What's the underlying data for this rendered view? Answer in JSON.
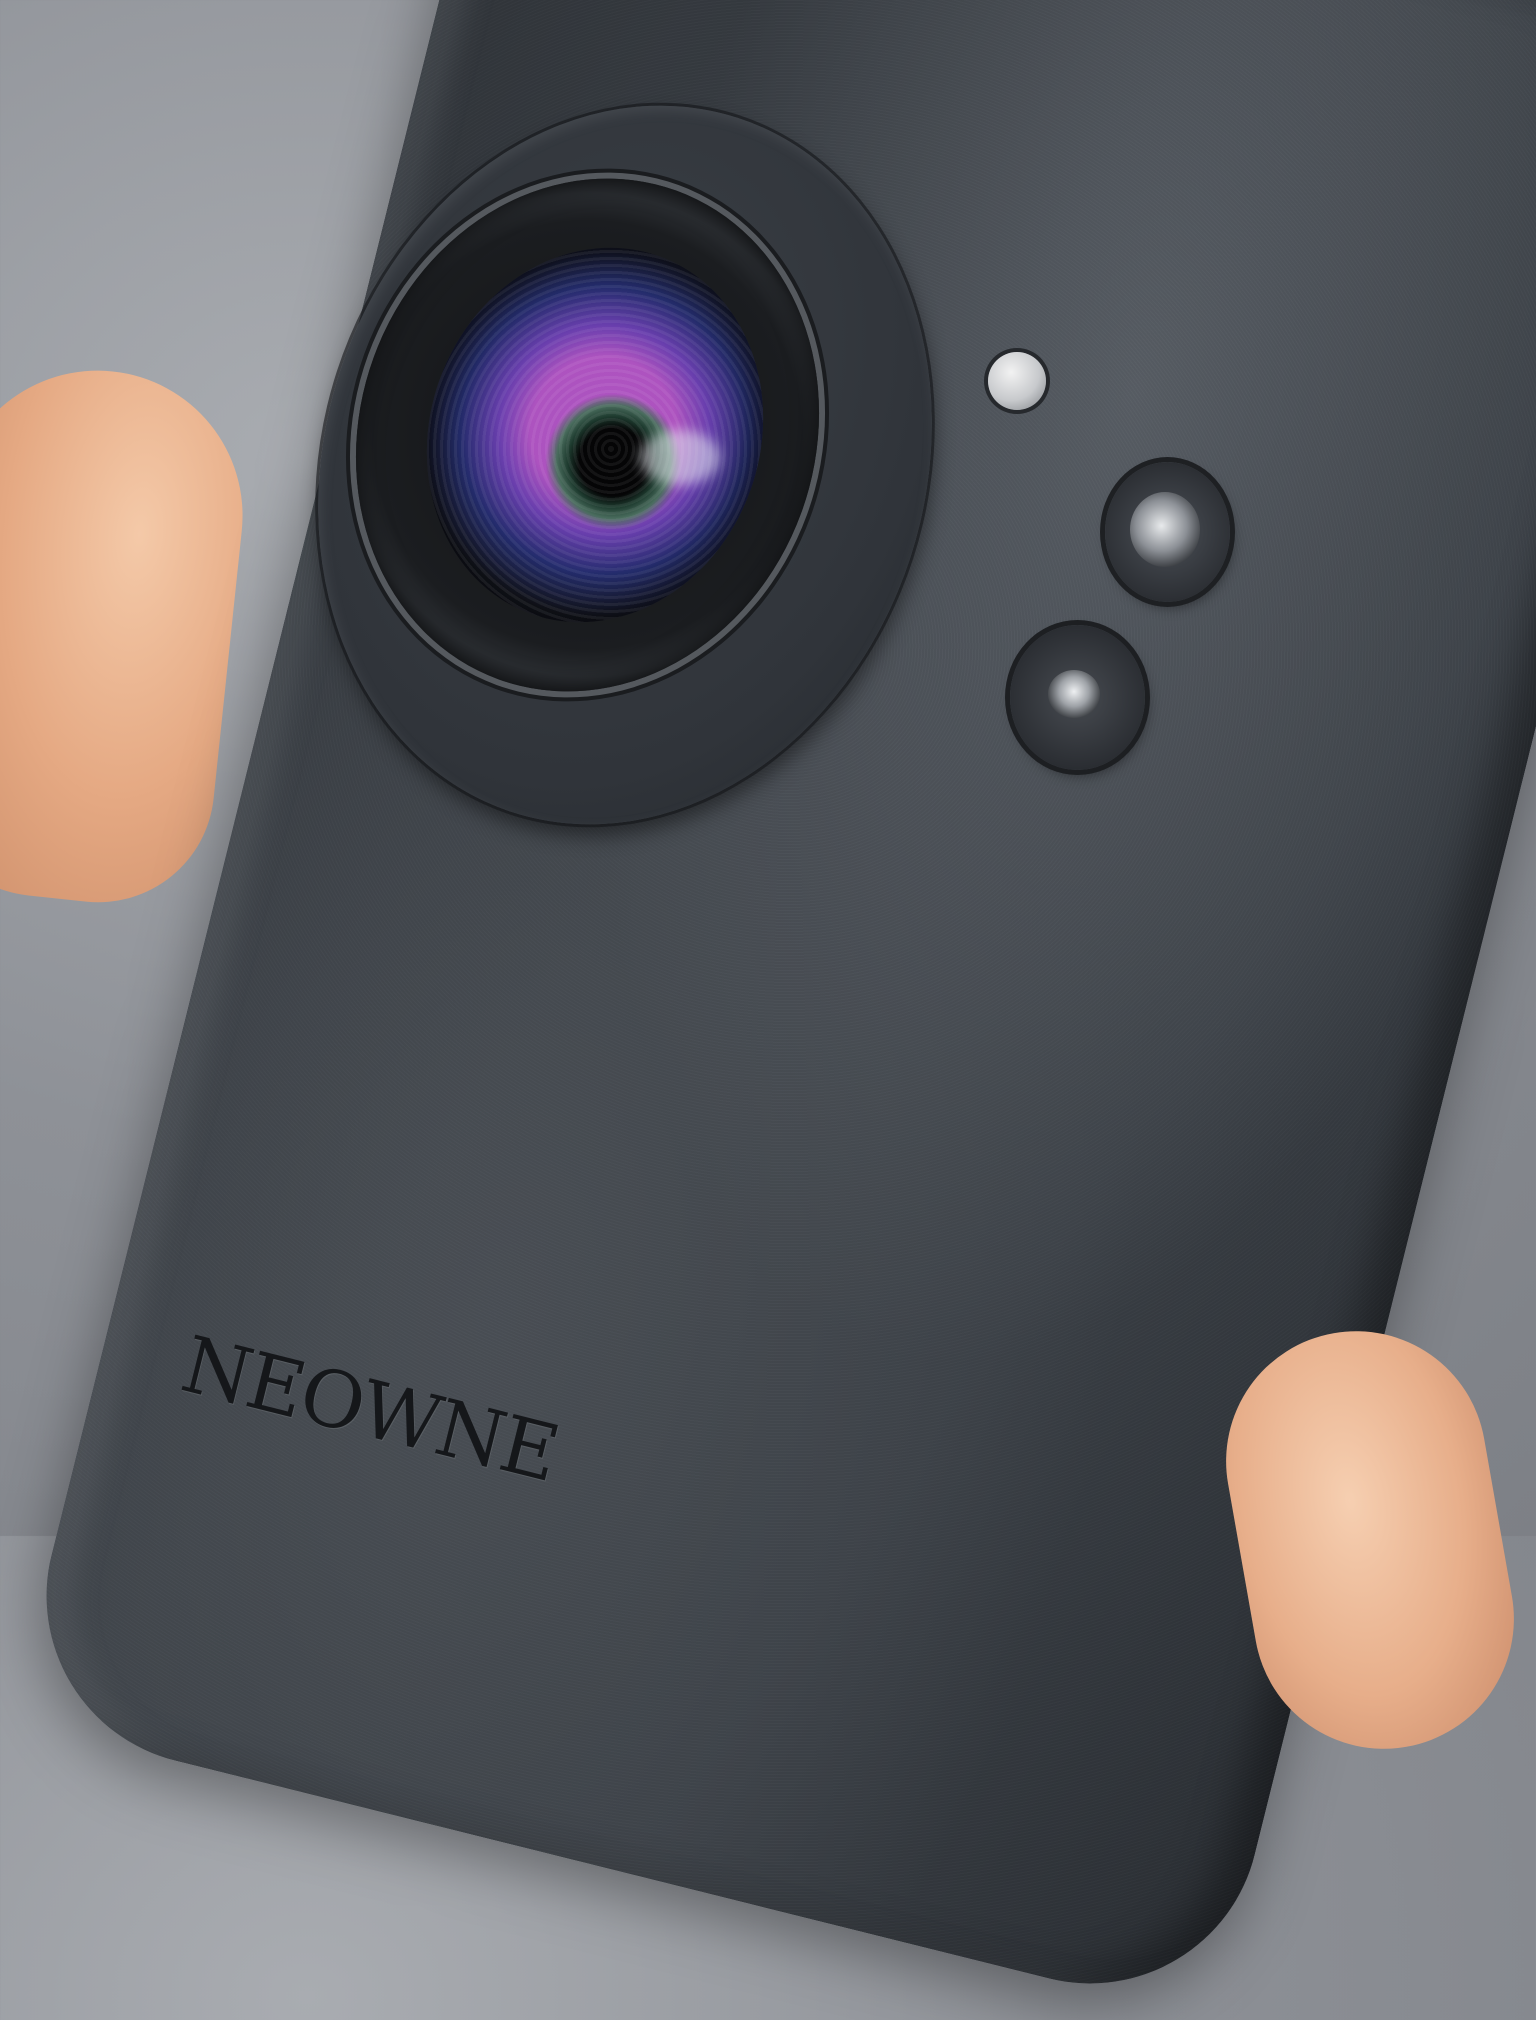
{
  "photo": {
    "brand_text": "NEOWNE"
  },
  "colors": {
    "phone_body": "#3a3f45",
    "background": "#8e9197",
    "skin": "#e5a983",
    "lens_purple": "#9b5ad2",
    "lens_blue": "#283282"
  },
  "icons": [
    "camera-lens-icon",
    "sensor-dot-icon",
    "flash-icon",
    "microphone-icon"
  ]
}
